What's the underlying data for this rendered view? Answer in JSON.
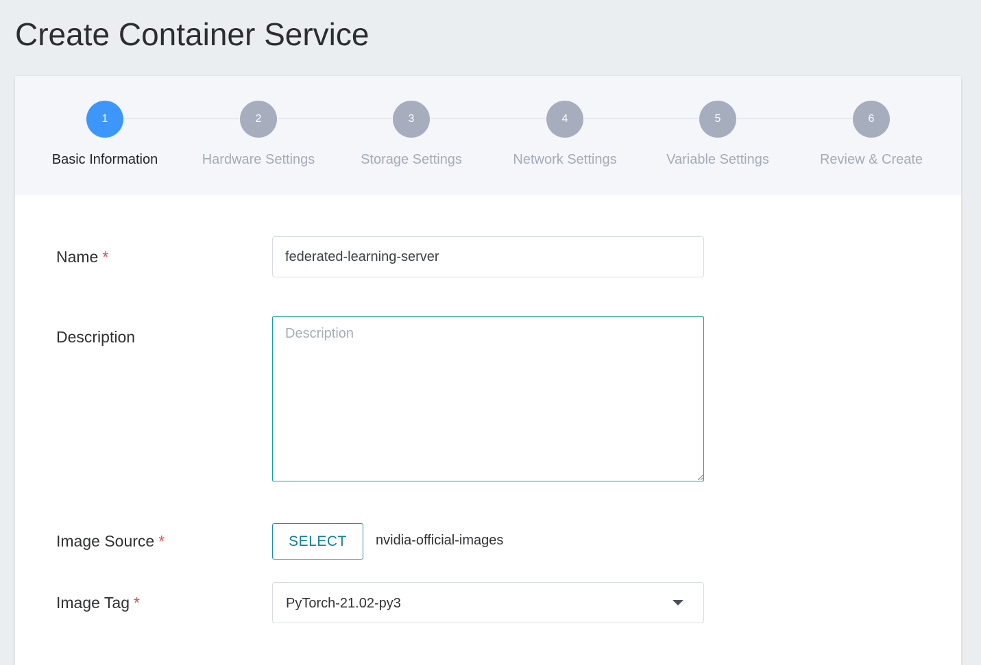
{
  "page": {
    "title": "Create Container Service"
  },
  "steps": [
    {
      "number": "1",
      "label": "Basic Information",
      "state": "active"
    },
    {
      "number": "2",
      "label": "Hardware Settings",
      "state": "inactive"
    },
    {
      "number": "3",
      "label": "Storage Settings",
      "state": "inactive"
    },
    {
      "number": "4",
      "label": "Network Settings",
      "state": "inactive"
    },
    {
      "number": "5",
      "label": "Variable Settings",
      "state": "inactive"
    },
    {
      "number": "6",
      "label": "Review & Create",
      "state": "inactive"
    }
  ],
  "form": {
    "required_marker": "*",
    "name": {
      "label": "Name",
      "value": "federated-learning-server"
    },
    "description": {
      "label": "Description",
      "placeholder": "Description",
      "value": ""
    },
    "image_source": {
      "label": "Image Source",
      "button_label": "SELECT",
      "selected_value": "nvidia-official-images"
    },
    "image_tag": {
      "label": "Image Tag",
      "selected_value": "PyTorch-21.02-py3"
    }
  },
  "colors": {
    "active_step": "#3d97fb",
    "inactive_step": "#a6adbd",
    "required": "#e5484d",
    "accent": "#137f97",
    "background": "#ebeef1"
  },
  "icons": {
    "image_tag_dropdown": "chevron-down-icon"
  }
}
